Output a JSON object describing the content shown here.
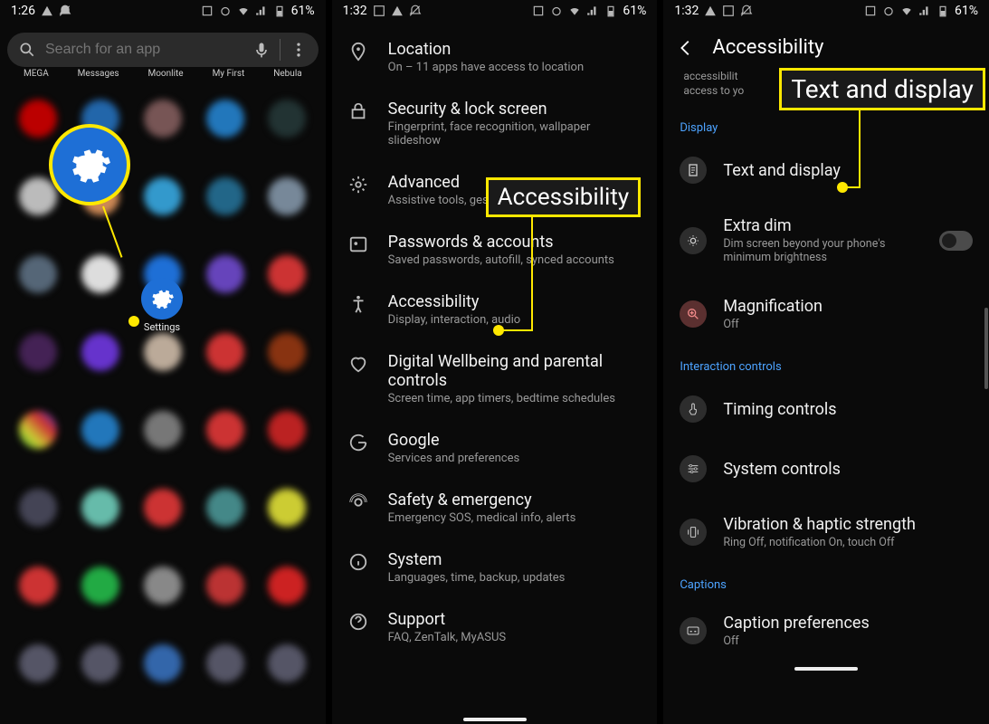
{
  "phone1": {
    "status": {
      "time": "1:26",
      "battery": "61%"
    },
    "search_placeholder": "Search for an app",
    "top_labels": [
      "MEGA",
      "Messages",
      "Moonlite",
      "My First",
      "Nebula"
    ],
    "settings_label": "Settings"
  },
  "phone2": {
    "status": {
      "time": "1:32",
      "battery": "61%"
    },
    "rows": [
      {
        "title": "Location",
        "sub": "On – 11 apps have access to location"
      },
      {
        "title": "Security & lock screen",
        "sub": "Fingerprint, face recognition, wallpaper slideshow"
      },
      {
        "title": "Advanced",
        "sub": "Assistive tools, gestures, touch sensitivity"
      },
      {
        "title": "Passwords & accounts",
        "sub": "Saved passwords, autofill, synced accounts"
      },
      {
        "title": "Accessibility",
        "sub": "Display, interaction, audio"
      },
      {
        "title": "Digital Wellbeing and parental controls",
        "sub": "Screen time, app timers, bedtime schedules"
      },
      {
        "title": "Google",
        "sub": "Services and preferences"
      },
      {
        "title": "Safety & emergency",
        "sub": "Emergency SOS, medical info, alerts"
      },
      {
        "title": "System",
        "sub": "Languages, time, backup, updates"
      },
      {
        "title": "Support",
        "sub": "FAQ, ZenTalk, MyASUS"
      }
    ],
    "callout": "Accessibility"
  },
  "phone3": {
    "status": {
      "time": "1:32",
      "battery": "61%"
    },
    "header": "Accessibility",
    "intro_fragment1": "accessibilit",
    "intro_fragment2": "access to yo",
    "sections": {
      "display": {
        "label": "Display",
        "text_and_display": "Text and display",
        "extra_dim": {
          "title": "Extra dim",
          "sub": "Dim screen beyond your phone's minimum brightness"
        },
        "magnification": {
          "title": "Magnification",
          "sub": "Off"
        }
      },
      "interaction": {
        "label": "Interaction controls",
        "timing": "Timing controls",
        "system": "System controls",
        "vibration": {
          "title": "Vibration & haptic strength",
          "sub": "Ring Off, notification On, touch Off"
        }
      },
      "captions": {
        "label": "Captions",
        "caption_prefs": {
          "title": "Caption preferences",
          "sub": "Off"
        }
      }
    },
    "callout": "Text and display"
  }
}
